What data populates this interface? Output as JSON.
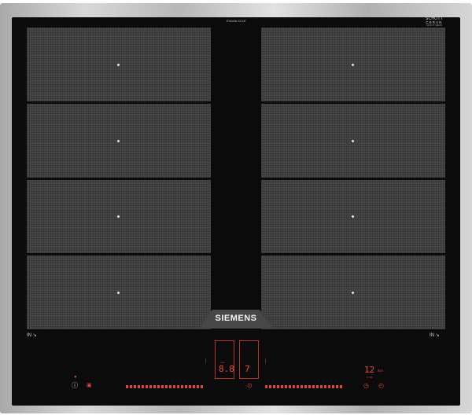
{
  "brand": {
    "logo": "SIEMENS",
    "small_top_text": "EX645LXC1E"
  },
  "glass_maker": {
    "line1": "SCHOTT",
    "line2": "CERAN",
    "line3": "SCHOTT CERAN"
  },
  "zones": {
    "left_count": 4,
    "right_count": 4
  },
  "side_labels": {
    "left": "IN",
    "right": "IN"
  },
  "controls": {
    "left_display_value": "8.8",
    "left_display_small": "ooo",
    "right_display_value": "7",
    "timer_value": "12",
    "timer_unit": "min",
    "timer_small": "0:00"
  },
  "icon_names": [
    "info-icon",
    "child-lock-icon",
    "power-move-icon",
    "timer-icon",
    "clock-icon",
    "cooktop-zone-icon"
  ],
  "colors": {
    "glass": "#0b0b0b",
    "zone": "#474747",
    "display": "#ef4a3f",
    "frame": "#c0c0c0"
  }
}
